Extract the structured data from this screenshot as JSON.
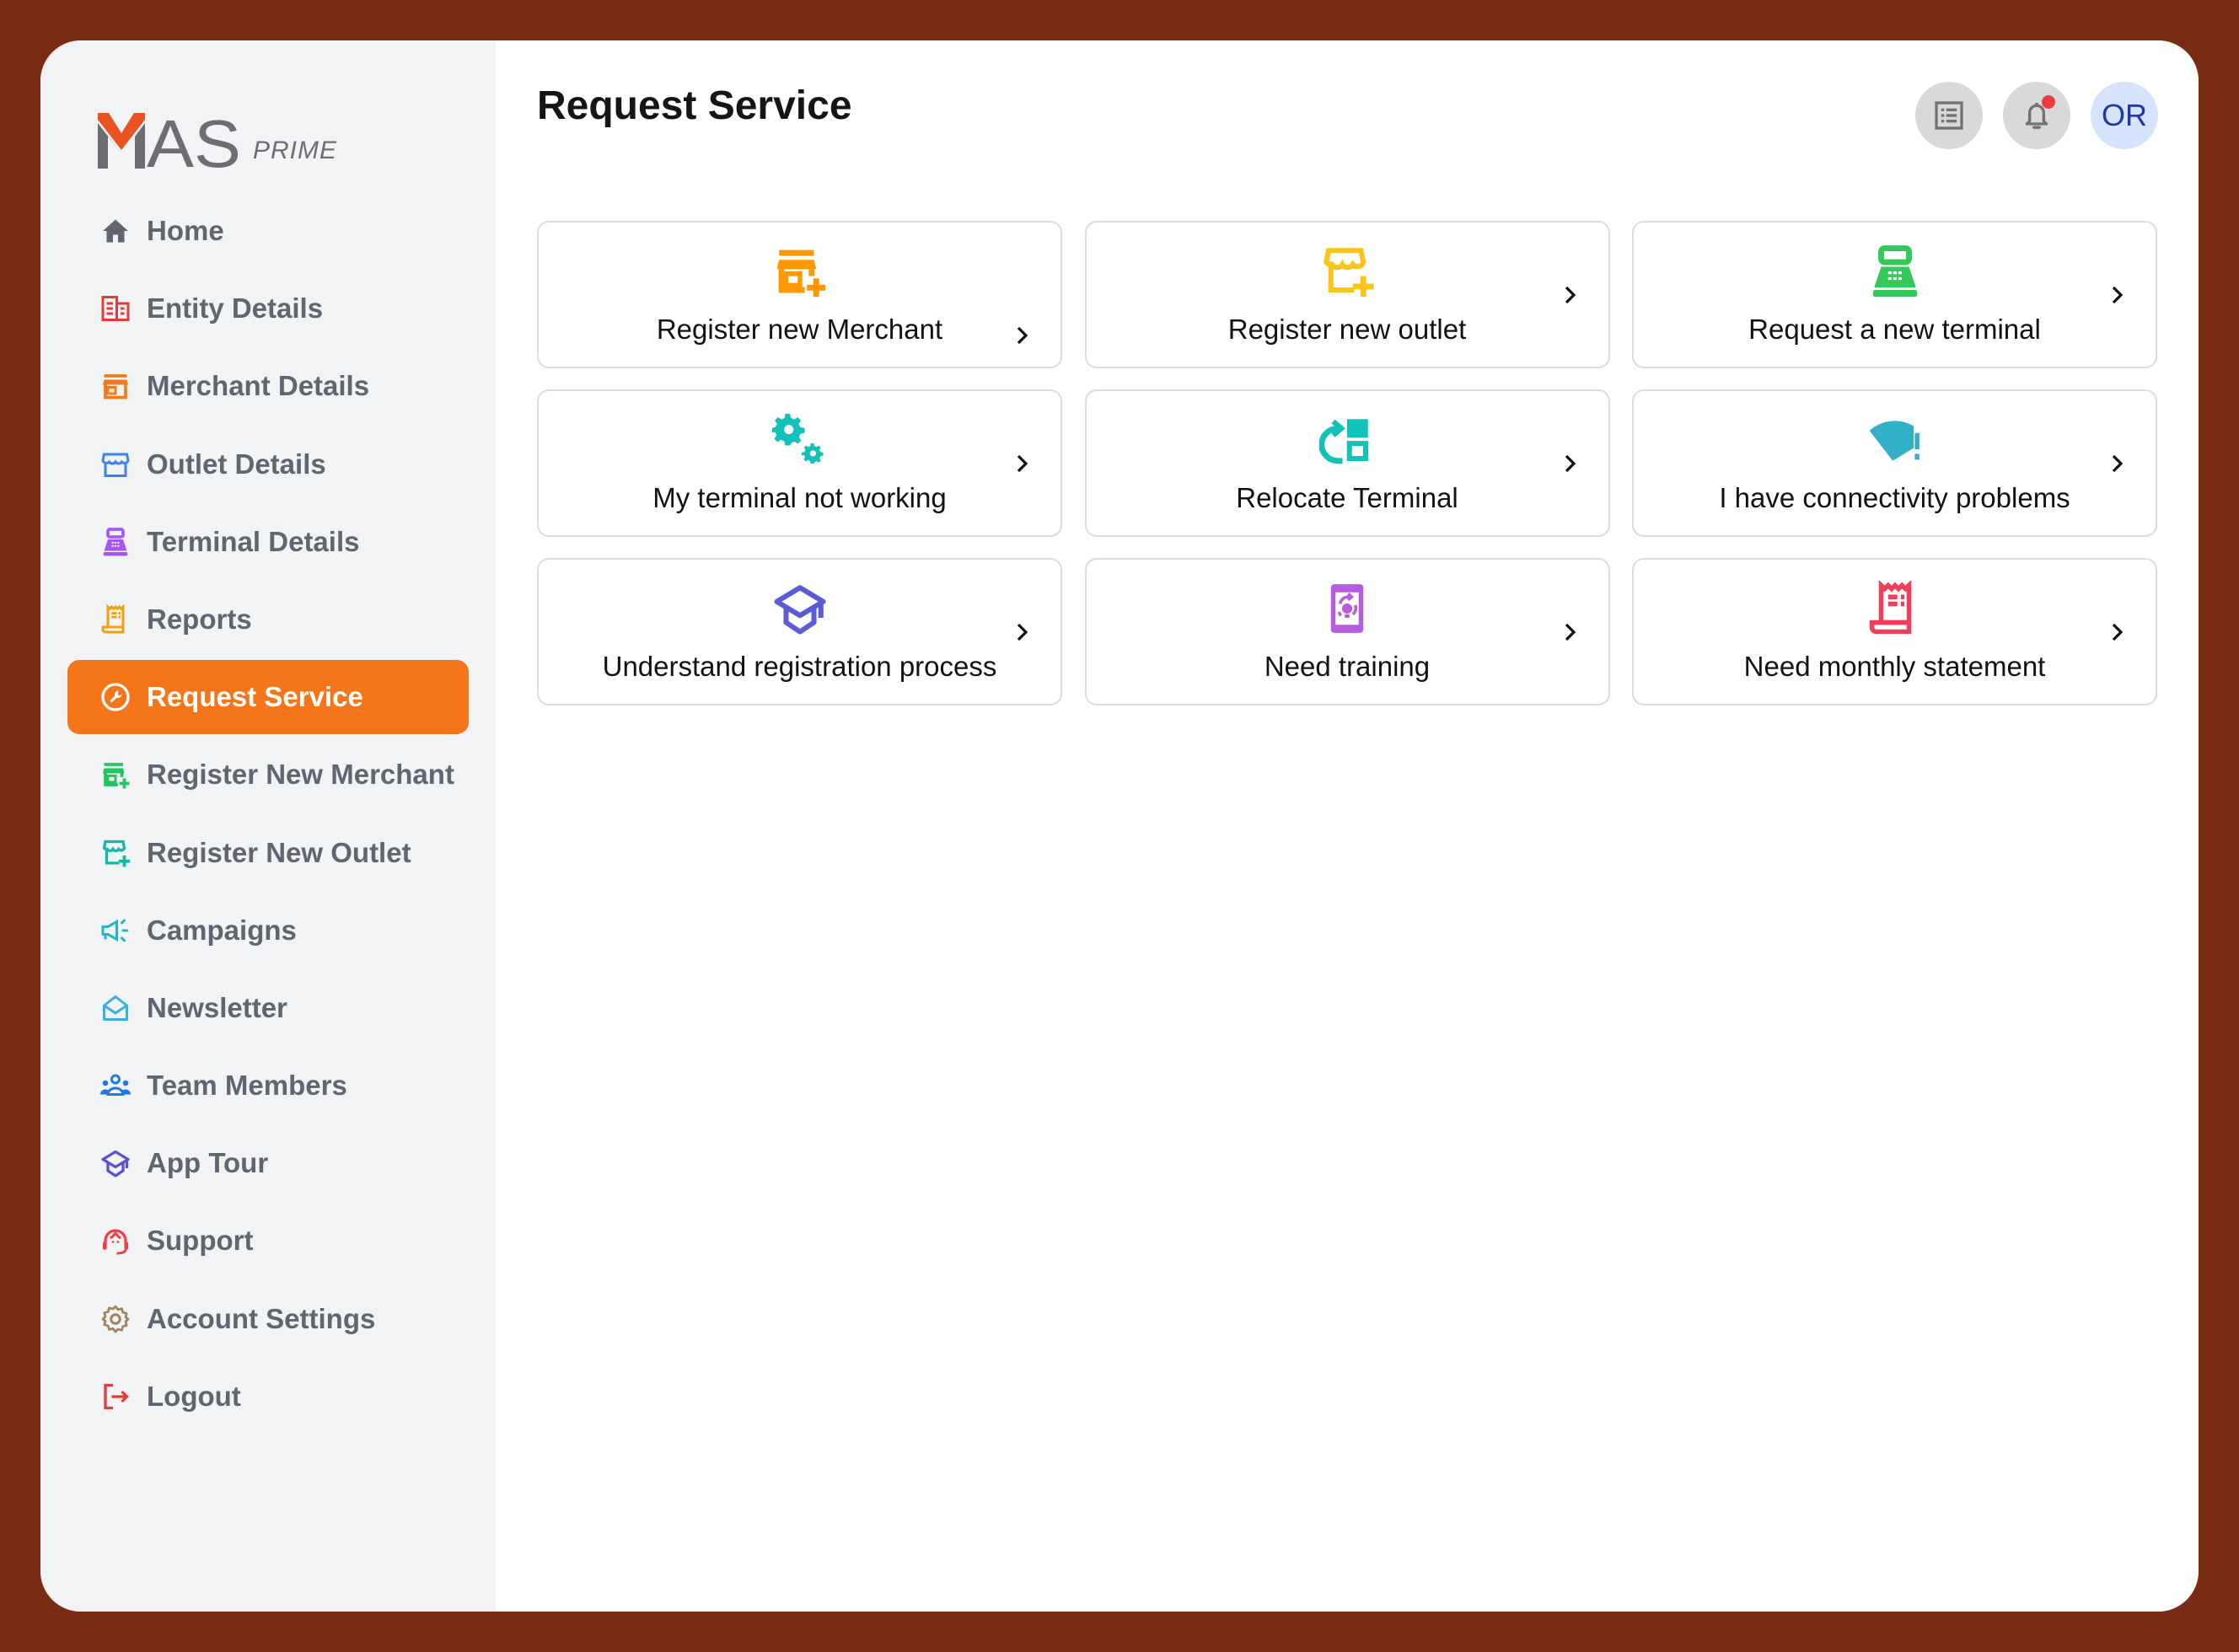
{
  "brand": {
    "logo_text": "MAS",
    "logo_sub": "PRIME",
    "accent": "#f5761a",
    "frame_color": "#7a2b13"
  },
  "sidebar": {
    "items": [
      {
        "label": "Home",
        "icon": "home-icon",
        "color": "#5f6670",
        "active": false
      },
      {
        "label": "Entity Details",
        "icon": "building-icon",
        "color": "#e63a3a",
        "active": false
      },
      {
        "label": "Merchant Details",
        "icon": "store-icon",
        "color": "#f07c1f",
        "active": false
      },
      {
        "label": "Outlet Details",
        "icon": "shop-awning-icon",
        "color": "#3b82f6",
        "active": false
      },
      {
        "label": "Terminal Details",
        "icon": "pos-terminal-icon",
        "color": "#a855f7",
        "active": false
      },
      {
        "label": "Reports",
        "icon": "receipt-icon",
        "color": "#f59e0b",
        "active": false
      },
      {
        "label": "Request Service",
        "icon": "wrench-circle-icon",
        "color": "#ffffff",
        "active": true
      },
      {
        "label": "Register New Merchant",
        "icon": "store-add-icon",
        "color": "#22c55e",
        "active": false
      },
      {
        "label": "Register New Outlet",
        "icon": "shop-add-icon",
        "color": "#14b8a6",
        "active": false
      },
      {
        "label": "Campaigns",
        "icon": "megaphone-icon",
        "color": "#22b5c4",
        "active": false
      },
      {
        "label": "Newsletter",
        "icon": "open-envelope-icon",
        "color": "#38aee6",
        "active": false
      },
      {
        "label": "Team Members",
        "icon": "team-icon",
        "color": "#1e7ae6",
        "active": false
      },
      {
        "label": "App Tour",
        "icon": "graduation-cap-icon",
        "color": "#5b4fd6",
        "active": false
      },
      {
        "label": "Support",
        "icon": "headset-icon",
        "color": "#ef3e4a",
        "active": false
      },
      {
        "label": "Account Settings",
        "icon": "gear-icon",
        "color": "#a0835e",
        "active": false
      },
      {
        "label": "Logout",
        "icon": "logout-icon",
        "color": "#e63a3a",
        "active": false
      }
    ]
  },
  "header": {
    "title": "Request Service",
    "avatar_initials": "OR",
    "has_notification": true
  },
  "services": [
    {
      "label": "Register new Merchant",
      "icon": "store-add-icon",
      "color": "#ff9800"
    },
    {
      "label": "Register new outlet",
      "icon": "shop-add-icon",
      "color": "#fcc419"
    },
    {
      "label": "Request a new terminal",
      "icon": "pos-terminal-icon",
      "color": "#34c759"
    },
    {
      "label": "My terminal not working",
      "icon": "gears-icon",
      "color": "#12c2b9"
    },
    {
      "label": "Relocate Terminal",
      "icon": "relocate-icon",
      "color": "#12c2b9"
    },
    {
      "label": "I have connectivity problems",
      "icon": "wifi-alert-icon",
      "color": "#32b0c8"
    },
    {
      "label": "Understand registration process",
      "icon": "graduation-cap-icon",
      "color": "#5b5bd6"
    },
    {
      "label": "Need training",
      "icon": "mobile-idea-icon",
      "color": "#b55ce0"
    },
    {
      "label": "Need monthly statement",
      "icon": "receipt-icon",
      "color": "#f23d5c"
    }
  ]
}
